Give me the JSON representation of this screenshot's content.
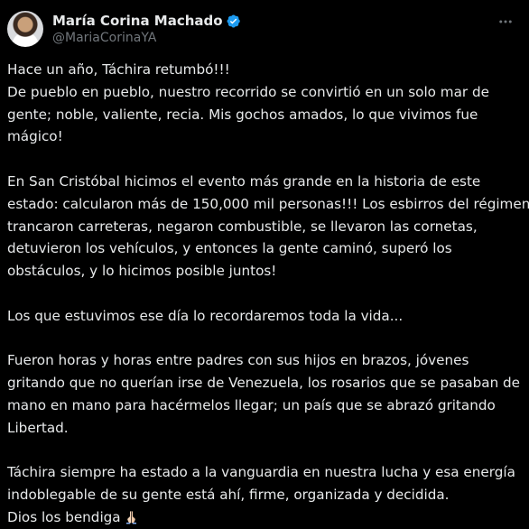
{
  "author": {
    "display_name": "María Corina Machado",
    "handle": "@MariaCorinaYA",
    "verified": true,
    "verified_color": "#1d9bf0"
  },
  "icons": {
    "more": "more-options-icon",
    "verified": "verified-badge-icon",
    "emoji": "folded-hands-emoji"
  },
  "tweet": {
    "paragraphs": [
      {
        "lines": [
          "Hace un año, Táchira retumbó!!!",
          "De pueblo en pueblo, nuestro recorrido se convirtió en un solo mar de",
          "gente; noble, valiente, recia. Mis gochos amados, lo que vivimos fue",
          "mágico!"
        ]
      },
      {
        "lines": [
          "En San Cristóbal hicimos el evento más grande en la historia de este",
          "estado: calcularon más de 150,000 mil personas!!! Los esbirros del régimen",
          "trancaron carreteras, negaron combustible, se llevaron las cornetas,",
          "detuvieron los vehículos, y entonces la gente caminó, superó los",
          "obstáculos, y lo hicimos posible juntos!"
        ]
      },
      {
        "lines": [
          "Los que estuvimos ese día lo recordaremos toda la vida..."
        ]
      },
      {
        "lines": [
          "Fueron horas y horas entre padres con sus hijos en brazos, jóvenes",
          "gritando que no querían irse de Venezuela, los rosarios que se pasaban de",
          "mano en mano para hacérmelos llegar; un país que se abrazó gritando",
          "Libertad."
        ]
      },
      {
        "lines": [
          "Táchira siempre ha estado a la vanguardia en nuestra lucha y esa energía",
          "indoblegable de su gente está ahí, firme, organizada y decidida.",
          "Dios los bendiga"
        ]
      }
    ]
  },
  "colors": {
    "background": "#000000",
    "text": "#e7e9ea",
    "secondary_text": "#71767b"
  }
}
